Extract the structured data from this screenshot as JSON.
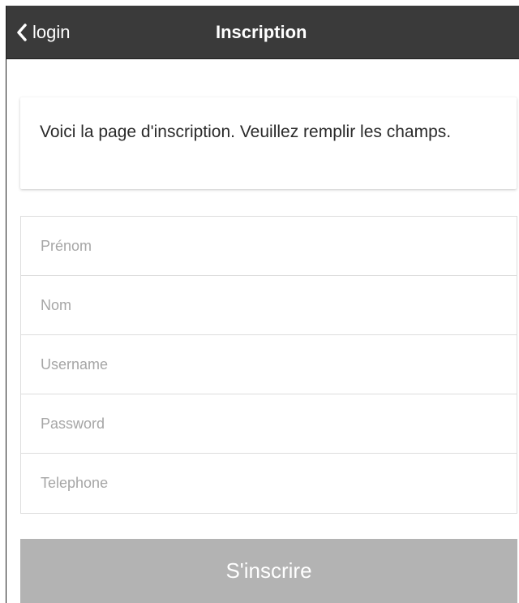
{
  "header": {
    "back_label": "login",
    "title": "Inscription"
  },
  "info": {
    "text": "Voici la page d'inscription. Veuillez remplir les champs."
  },
  "form": {
    "fields": [
      {
        "placeholder": "Prénom",
        "value": ""
      },
      {
        "placeholder": "Nom",
        "value": ""
      },
      {
        "placeholder": "Username",
        "value": ""
      },
      {
        "placeholder": "Password",
        "value": ""
      },
      {
        "placeholder": "Telephone",
        "value": ""
      }
    ],
    "submit_label": "S'inscrire"
  },
  "icons": {
    "back": "chevron-left-icon"
  },
  "colors": {
    "header_bg": "#3a3a3a",
    "button_bg": "#b3b3b3",
    "placeholder": "#a6a6a6"
  }
}
